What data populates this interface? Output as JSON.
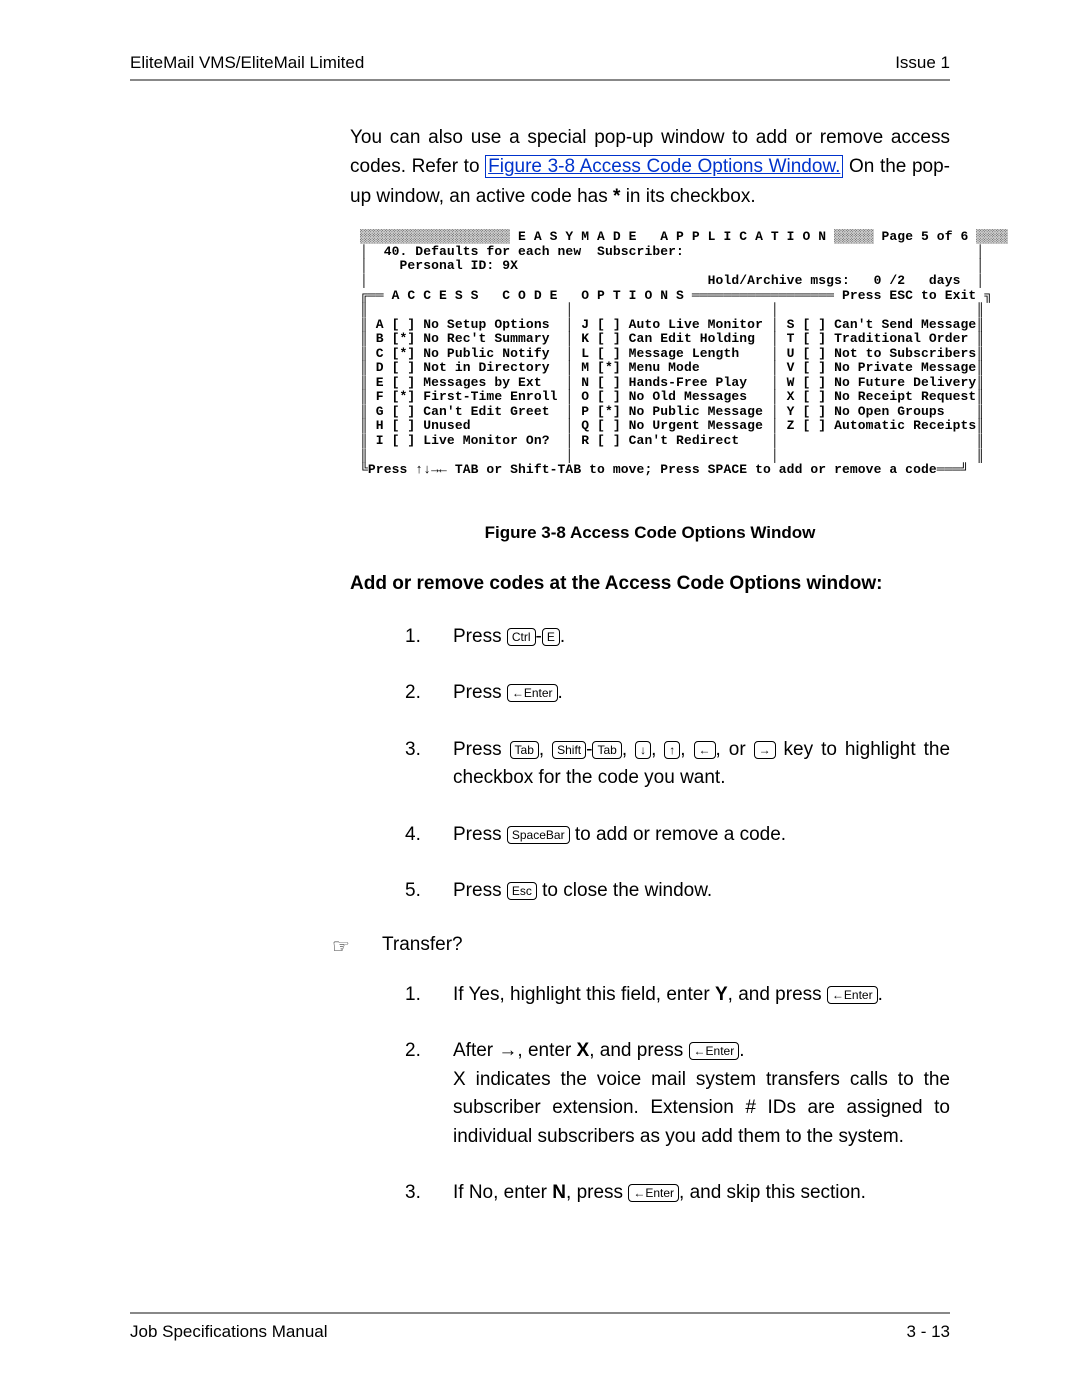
{
  "header": {
    "left": "EliteMail VMS/EliteMail Limited",
    "right": "Issue 1"
  },
  "intro": {
    "pre_link": "You can also use a special pop-up window to add or remove access codes.  Refer to ",
    "link": "Figure 3-8 Access Code Options Window.",
    "post_link": " On the pop-up window, an active code has ",
    "star": "*",
    "tail": " in its checkbox."
  },
  "terminal": {
    "title": " E A S Y M A D E   A P P L I C A T I O N ",
    "page": " Page 5 of 6 ",
    "line40": "  40. Defaults for each new  Subscriber:",
    "pid": "    Personal ID: 9X",
    "hold": "                                           Hold/Archive msgs:   0 /2   days",
    "box_title": " A C C E S S   C O D E   O P T I O N S ",
    "exit": " Press ESC to Exit ",
    "col1": [
      "A [ ] No Setup Options",
      "B [*] No Rec't Summary",
      "C [*] No Public Notify",
      "D [ ] Not in Directory",
      "E [ ] Messages by Ext",
      "F [*] First-Time Enroll",
      "G [ ] Can't Edit Greet",
      "H [ ] Unused",
      "I [ ] Live Monitor On?"
    ],
    "col2": [
      "J [ ] Auto Live Monitor",
      "K [ ] Can Edit Holding",
      "L [ ] Message Length",
      "M [*] Menu Mode",
      "N [ ] Hands-Free Play",
      "O [ ] No Old Messages",
      "P [*] No Public Message",
      "Q [ ] No Urgent Message",
      "R [ ] Can't Redirect"
    ],
    "col3": [
      "S [ ] Can't Send Message",
      "T [ ] Traditional Order",
      "U [ ] Not to Subscribers",
      "V [ ] No Private Message",
      "W [ ] No Future Delivery",
      "X [ ] No Receipt Request",
      "Y [ ] No Open Groups",
      "Z [ ] Automatic Receipts",
      ""
    ],
    "footer": "Press ↑↓→← TAB or Shift-TAB to move; Press SPACE to add or remove a code"
  },
  "caption": "Figure 3-8    Access Code Options Window",
  "section_head": "Add or remove codes at the Access Code Options window:",
  "steps1": {
    "s1": {
      "n": "1.",
      "a": "Press ",
      "k1": "Ctrl",
      "dash": "-",
      "k2": "E",
      "b": "."
    },
    "s2": {
      "n": "2.",
      "a": "Press ",
      "k1": "←Enter",
      "b": "."
    },
    "s3": {
      "n": "3.",
      "a": "Press ",
      "t": [
        "Tab",
        "Shift",
        "Tab",
        "↓",
        "↑",
        "←",
        "→"
      ],
      "b": " key to highlight the checkbox for the code you want."
    },
    "s4": {
      "n": "4.",
      "a": "Press ",
      "k1": "SpaceBar",
      "b": " to add or remove a code."
    },
    "s5": {
      "n": "5.",
      "a": "Press ",
      "k1": "Esc",
      "b": " to close the window."
    }
  },
  "transfer_label": "Transfer?",
  "steps2": {
    "s1": {
      "n": "1.",
      "a": "If Yes, highlight this field, enter ",
      "bold": "Y",
      "b": ", and press ",
      "k": "←Enter",
      "c": "."
    },
    "s2": {
      "n": "2.",
      "a": "After →, enter ",
      "bold": "X",
      "b": ", and press ",
      "k": "←Enter",
      "c": ".",
      "body": "X indicates the voice mail system transfers calls to the subscriber extension.  Extension # IDs are assigned to individual subscribers as you add them to the system."
    },
    "s3": {
      "n": "3.",
      "a": "If No, enter ",
      "bold": "N",
      "b": ", press ",
      "k": "←Enter",
      "c": ",  and skip this section."
    }
  },
  "footer": {
    "left": "Job Specifications Manual",
    "right": "3 - 13"
  }
}
